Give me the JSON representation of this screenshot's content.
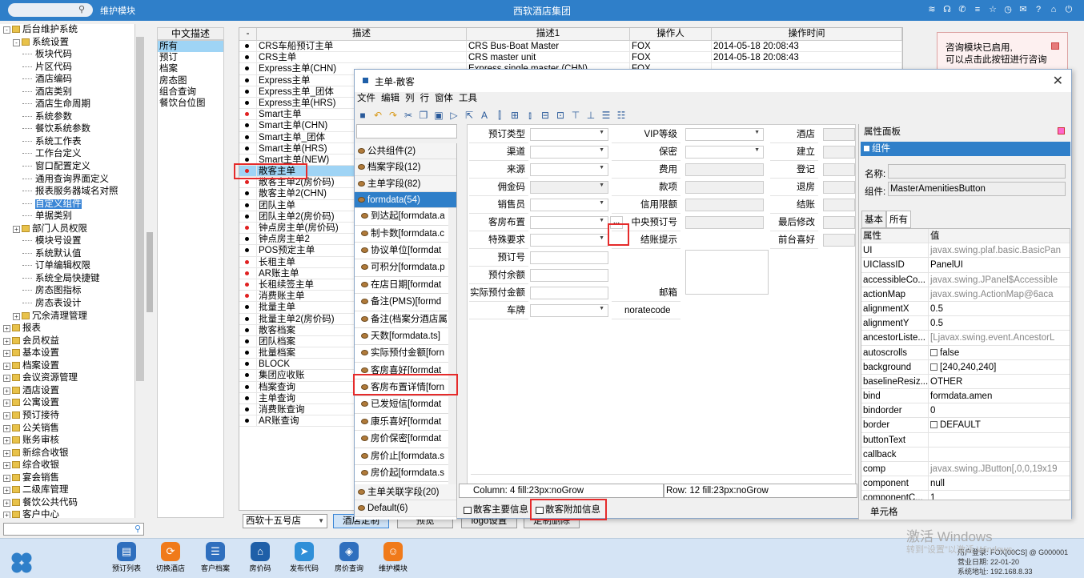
{
  "topbar": {
    "module": "维护模块",
    "title": "西软酒店集团"
  },
  "tree": [
    {
      "label": "后台维护系统",
      "level": 0,
      "type": "root"
    },
    {
      "label": "系统设置",
      "level": 1,
      "type": "open"
    },
    {
      "label": "板块代码",
      "level": 2,
      "type": "leaf"
    },
    {
      "label": "片区代码",
      "level": 2,
      "type": "leaf"
    },
    {
      "label": "酒店编码",
      "level": 2,
      "type": "leaf"
    },
    {
      "label": "酒店类别",
      "level": 2,
      "type": "leaf"
    },
    {
      "label": "酒店生命周期",
      "level": 2,
      "type": "leaf"
    },
    {
      "label": "系统参数",
      "level": 2,
      "type": "leaf"
    },
    {
      "label": "餐饮系统参数",
      "level": 2,
      "type": "leaf"
    },
    {
      "label": "系统工作表",
      "level": 2,
      "type": "leaf"
    },
    {
      "label": "工作台定义",
      "level": 2,
      "type": "leaf"
    },
    {
      "label": "窗口配置定义",
      "level": 2,
      "type": "leaf"
    },
    {
      "label": "通用查询界面定义",
      "level": 2,
      "type": "leaf"
    },
    {
      "label": "报表服务器域名对照",
      "level": 2,
      "type": "leaf"
    },
    {
      "label": "自定义组件",
      "level": 2,
      "type": "leaf",
      "selected": true
    },
    {
      "label": "单据类别",
      "level": 2,
      "type": "leaf"
    },
    {
      "label": "部门人员权限",
      "level": 1,
      "type": "closed"
    },
    {
      "label": "模块号设置",
      "level": 2,
      "type": "leaf"
    },
    {
      "label": "系统默认值",
      "level": 2,
      "type": "leaf"
    },
    {
      "label": "订单编辑权限",
      "level": 2,
      "type": "leaf"
    },
    {
      "label": "系统全局快捷键",
      "level": 2,
      "type": "leaf"
    },
    {
      "label": "房态图指标",
      "level": 2,
      "type": "leaf"
    },
    {
      "label": "房态表设计",
      "level": 2,
      "type": "leaf"
    },
    {
      "label": "冗余清理管理",
      "level": 1,
      "type": "closed"
    },
    {
      "label": "报表",
      "level": 0,
      "type": "closed"
    },
    {
      "label": "会员权益",
      "level": 0,
      "type": "closed"
    },
    {
      "label": "基本设置",
      "level": 0,
      "type": "closed"
    },
    {
      "label": "档案设置",
      "level": 0,
      "type": "closed"
    },
    {
      "label": "会议资源管理",
      "level": 0,
      "type": "closed"
    },
    {
      "label": "酒店设置",
      "level": 0,
      "type": "closed"
    },
    {
      "label": "公寓设置",
      "level": 0,
      "type": "closed"
    },
    {
      "label": "预订接待",
      "level": 0,
      "type": "closed"
    },
    {
      "label": "公关销售",
      "level": 0,
      "type": "closed"
    },
    {
      "label": "账务审核",
      "level": 0,
      "type": "closed"
    },
    {
      "label": "新综合收银",
      "level": 0,
      "type": "closed"
    },
    {
      "label": "综合收银",
      "level": 0,
      "type": "closed"
    },
    {
      "label": "宴会销售",
      "level": 0,
      "type": "closed"
    },
    {
      "label": "二级库管理",
      "level": 0,
      "type": "closed"
    },
    {
      "label": "餐饮公共代码",
      "level": 0,
      "type": "closed"
    },
    {
      "label": "客户中心",
      "level": 0,
      "type": "closed"
    }
  ],
  "list2": {
    "header": "中文描述",
    "items": [
      "所有",
      "预订",
      "档案",
      "房态图",
      "组合查询",
      "餐饮台位图"
    ]
  },
  "grid": {
    "headers": [
      "-",
      "描述",
      "描述1",
      "操作人",
      "操作时间"
    ],
    "rows": [
      {
        "dot": "black",
        "desc": "CRS车船预订主单",
        "desc1": "CRS Bus-Boat Master",
        "op": "FOX",
        "time": "2014-05-18 20:08:43"
      },
      {
        "dot": "black",
        "desc": "CRS主单",
        "desc1": "CRS master unit",
        "op": "FOX",
        "time": "2014-05-18 20:08:43"
      },
      {
        "dot": "black",
        "desc": "Express主单(CHN)",
        "desc1": "Express single master (CHN)",
        "op": "FOX",
        "time": ""
      },
      {
        "dot": "black",
        "desc": "Express主单",
        "desc1": "",
        "op": "",
        "time": ""
      },
      {
        "dot": "black",
        "desc": "Express主单_团体",
        "desc1": "",
        "op": "",
        "time": ""
      },
      {
        "dot": "black",
        "desc": "Express主单(HRS)",
        "desc1": "",
        "op": "",
        "time": ""
      },
      {
        "dot": "red",
        "desc": "Smart主单",
        "desc1": "",
        "op": "",
        "time": ""
      },
      {
        "dot": "black",
        "desc": "Smart主单(CHN)",
        "desc1": "",
        "op": "",
        "time": ""
      },
      {
        "dot": "black",
        "desc": "Smart主单_团体",
        "desc1": "",
        "op": "",
        "time": ""
      },
      {
        "dot": "black",
        "desc": "Smart主单(HRS)",
        "desc1": "",
        "op": "",
        "time": ""
      },
      {
        "dot": "black",
        "desc": "Smart主单(NEW)",
        "desc1": "",
        "op": "",
        "time": ""
      },
      {
        "dot": "red",
        "desc": "散客主单",
        "desc1": "",
        "op": "",
        "time": "",
        "selected": true
      },
      {
        "dot": "red",
        "desc": "散客主单2(房价码)",
        "desc1": "",
        "op": "",
        "time": ""
      },
      {
        "dot": "black",
        "desc": "散客主单2(CHN)",
        "desc1": "",
        "op": "",
        "time": ""
      },
      {
        "dot": "black",
        "desc": "团队主单",
        "desc1": "",
        "op": "",
        "time": ""
      },
      {
        "dot": "black",
        "desc": "团队主单2(房价码)",
        "desc1": "",
        "op": "",
        "time": ""
      },
      {
        "dot": "red",
        "desc": "钟点房主单(房价码)",
        "desc1": "",
        "op": "",
        "time": ""
      },
      {
        "dot": "black",
        "desc": "钟点房主单2",
        "desc1": "",
        "op": "",
        "time": ""
      },
      {
        "dot": "black",
        "desc": "POS预定主单",
        "desc1": "",
        "op": "",
        "time": ""
      },
      {
        "dot": "red",
        "desc": "长租主单",
        "desc1": "",
        "op": "",
        "time": ""
      },
      {
        "dot": "red",
        "desc": "AR账主单",
        "desc1": "",
        "op": "",
        "time": ""
      },
      {
        "dot": "red",
        "desc": "长租续签主单",
        "desc1": "",
        "op": "",
        "time": ""
      },
      {
        "dot": "red",
        "desc": "消费账主单",
        "desc1": "",
        "op": "",
        "time": ""
      },
      {
        "dot": "black",
        "desc": "批量主单",
        "desc1": "",
        "op": "",
        "time": ""
      },
      {
        "dot": "black",
        "desc": "批量主单2(房价码)",
        "desc1": "",
        "op": "",
        "time": ""
      },
      {
        "dot": "black",
        "desc": "散客档案",
        "desc1": "",
        "op": "",
        "time": ""
      },
      {
        "dot": "black",
        "desc": "团队档案",
        "desc1": "",
        "op": "",
        "time": ""
      },
      {
        "dot": "black",
        "desc": "批量档案",
        "desc1": "",
        "op": "",
        "time": ""
      },
      {
        "dot": "black",
        "desc": "BLOCK",
        "desc1": "",
        "op": "",
        "time": ""
      },
      {
        "dot": "black",
        "desc": "集团应收账",
        "desc1": "",
        "op": "",
        "time": ""
      },
      {
        "dot": "black",
        "desc": "档案查询",
        "desc1": "",
        "op": "",
        "time": ""
      },
      {
        "dot": "black",
        "desc": "主单查询",
        "desc1": "",
        "op": "",
        "time": ""
      },
      {
        "dot": "black",
        "desc": "消费账查询",
        "desc1": "",
        "op": "",
        "time": ""
      },
      {
        "dot": "black",
        "desc": "AR账查询",
        "desc1": "",
        "op": "",
        "time": ""
      }
    ]
  },
  "bottom": {
    "hotel": "西软十五号店",
    "buttons": [
      "酒店定制",
      "预览",
      "logo设置",
      "定制删除"
    ]
  },
  "notice": {
    "line1": "咨询模块已启用,",
    "line2": "可以点击此按钮进行咨询"
  },
  "dialog": {
    "title": "主单-散客",
    "menu": [
      "文件",
      "编辑",
      "列",
      "行",
      "窗体",
      "工具"
    ],
    "accordion": {
      "groups_top": [
        "公共组件(2)",
        "档案字段(12)",
        "主单字段(82)",
        "formdata(54)"
      ],
      "items": [
        "到达起[formdata.a",
        "制卡数[formdata.c",
        "协议单位[formdat",
        "可积分[formdata.p",
        "在店日期[formdat",
        "备注(PMS)[formd",
        "备注(档案分酒店属",
        "天数[formdata.ts]",
        "实际预付金额[forn",
        "客房喜好[formdat",
        "客房布置详情[forn",
        "已发短信[formdat",
        "康乐喜好[formdat",
        "房价保密[formdat",
        "房价止[formdata.s",
        "房价起[formdata.s"
      ],
      "groups_bottom": [
        "主单关联字段(20)",
        "Default(6)"
      ]
    },
    "form": {
      "labels_col1": [
        "预订类型",
        "渠道",
        "来源",
        "佣金码",
        "销售员",
        "客房布置",
        "特殊要求",
        "预订号",
        "预付余额",
        "实际预付金额",
        "车牌"
      ],
      "labels_col2": [
        "VIP等级",
        "保密",
        "费用",
        "款项",
        "信用限额",
        "中央预订号",
        "结账提示",
        "",
        "",
        "邮箱",
        "noratecode"
      ],
      "labels_col3": [
        "酒店",
        "建立",
        "登记",
        "退房",
        "结账",
        "最后修改",
        "前台喜好"
      ],
      "ellipsis": "..."
    },
    "status": {
      "column": "Column: 4  fill:23px:noGrow",
      "row": "Row: 12  fill:23px:noGrow"
    },
    "tabs": [
      "散客主要信息",
      "散客附加信息"
    ],
    "props": {
      "header": "属性面板",
      "sub": "组件",
      "name_label": "名称:",
      "name_value": "",
      "comp_label": "组件:",
      "comp_value": "MasterAmenitiesButton",
      "tab_basic": "基本",
      "tab_all": "所有",
      "table_headers": [
        "属性",
        "值"
      ],
      "rows": [
        {
          "k": "UI",
          "v": "javax.swing.plaf.basic.BasicPan",
          "grey": true
        },
        {
          "k": "UIClassID",
          "v": "PanelUI"
        },
        {
          "k": "accessibleCo...",
          "v": "javax.swing.JPanel$Accessible",
          "grey": true
        },
        {
          "k": "actionMap",
          "v": "javax.swing.ActionMap@6aca",
          "grey": true
        },
        {
          "k": "alignmentX",
          "v": "0.5"
        },
        {
          "k": "alignmentY",
          "v": "0.5"
        },
        {
          "k": "ancestorListe...",
          "v": "[Ljavax.swing.event.AncestorL",
          "grey": true
        },
        {
          "k": "autoscrolls",
          "v": "false",
          "chk": true
        },
        {
          "k": "background",
          "v": "[240,240,240]",
          "chk": true
        },
        {
          "k": "baselineResiz...",
          "v": "OTHER"
        },
        {
          "k": "bind",
          "v": "formdata.amen"
        },
        {
          "k": "bindorder",
          "v": "0"
        },
        {
          "k": "border",
          "v": "DEFAULT",
          "chk": true
        },
        {
          "k": "buttonText",
          "v": ""
        },
        {
          "k": "callback",
          "v": ""
        },
        {
          "k": "comp",
          "v": "javax.swing.JButton[,0,0,19x19",
          "grey": true
        },
        {
          "k": "component",
          "v": "null"
        },
        {
          "k": "componentC...",
          "v": "1"
        }
      ],
      "footer": "单元格"
    }
  },
  "taskbar": [
    {
      "label": "预订列表",
      "color": "#2f6fbe",
      "glyph": "▤"
    },
    {
      "label": "切换酒店",
      "color": "#f07a1a",
      "glyph": "⟳"
    },
    {
      "label": "客户档案",
      "color": "#2f6fbe",
      "glyph": "☰"
    },
    {
      "label": "房价码",
      "color": "#1f5fa8",
      "glyph": "⌂"
    },
    {
      "label": "发布代码",
      "color": "#2f8fd8",
      "glyph": "➤"
    },
    {
      "label": "房价查询",
      "color": "#2f6fbe",
      "glyph": "◈"
    },
    {
      "label": "维护模块",
      "color": "#f07a1a",
      "glyph": "☺"
    }
  ],
  "sysinfo": {
    "line1": "用户登录: FOX[00CS] @ G000001",
    "line2": "营业日期: 22-01-20",
    "line3": "系统地址: 192.168.8.33"
  },
  "watermark": {
    "line1": "激活 Windows",
    "line2": "转到\"设置\"以激活 Windows。"
  }
}
